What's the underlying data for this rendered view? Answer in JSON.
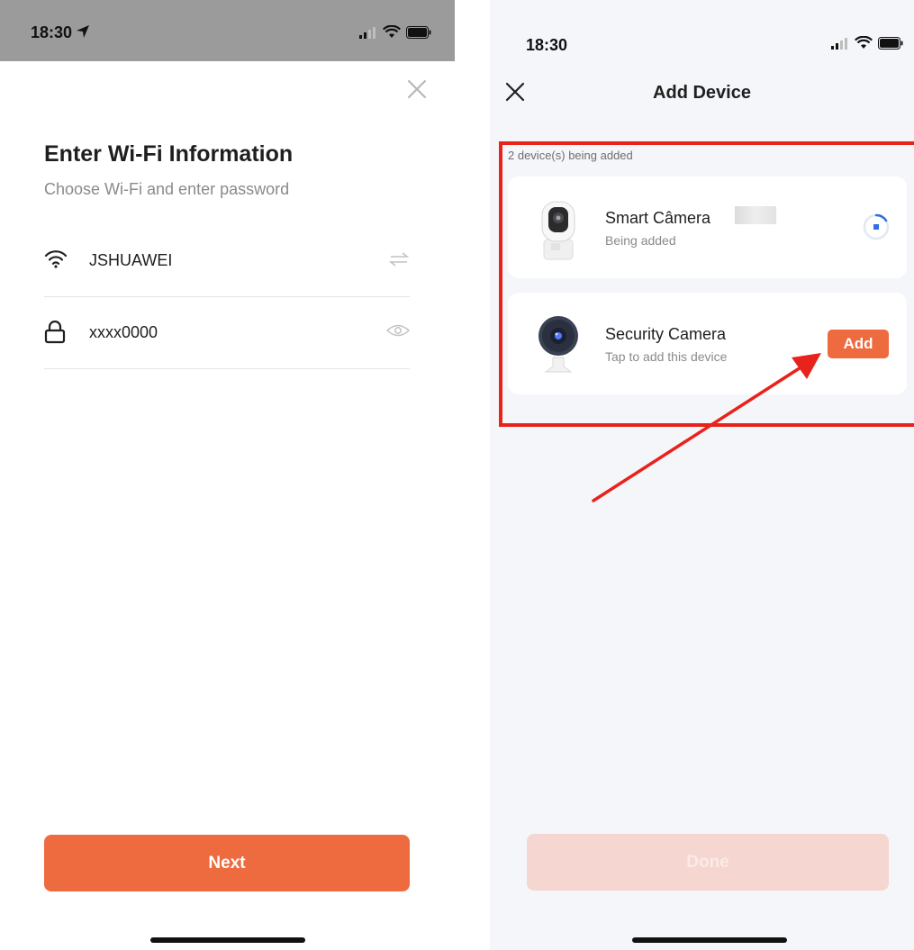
{
  "left_screen": {
    "status_bar": {
      "time": "18:30"
    },
    "title": "Enter Wi-Fi Information",
    "subtitle": "Choose Wi-Fi and enter password",
    "wifi": {
      "ssid": "JSHUAWEI"
    },
    "password": {
      "value": "xxxx0000"
    },
    "next_label": "Next"
  },
  "right_screen": {
    "status_bar": {
      "time": "18:30"
    },
    "nav_title": "Add Device",
    "device_count_label": "2 device(s) being added",
    "devices": [
      {
        "name": "Smart Câmera",
        "status": "Being added"
      },
      {
        "name": "Security Camera",
        "status": "Tap to add this device",
        "action_label": "Add"
      }
    ],
    "done_label": "Done"
  },
  "colors": {
    "accent": "#ee6a3f",
    "highlight": "#e8231b",
    "progress": "#2f6fe0",
    "done_disabled": "#f6d6d0"
  }
}
